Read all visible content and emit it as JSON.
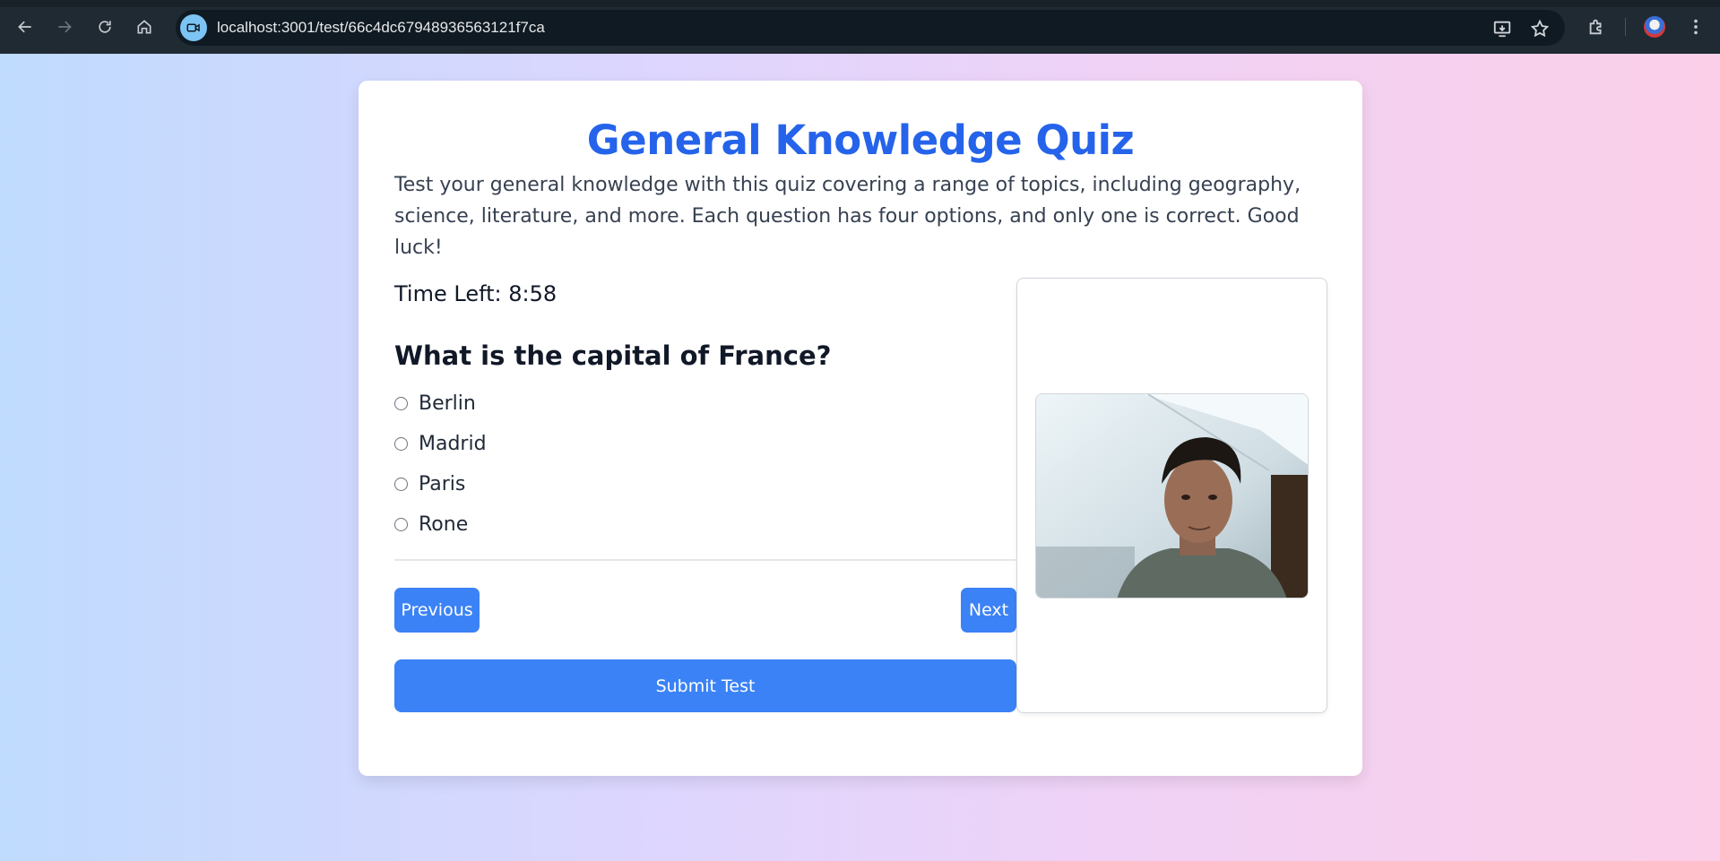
{
  "browser": {
    "url": "localhost:3001/test/66c4dc67948936563121f7ca"
  },
  "quiz": {
    "title": "General Knowledge Quiz",
    "description": "Test your general knowledge with this quiz covering a range of topics, including geography, science, literature, and more. Each question has four options, and only one is correct. Good luck!",
    "timer": "Time Left: 8:58",
    "question": "What is the capital of France?",
    "options": [
      "Berlin",
      "Madrid",
      "Paris",
      "Rone"
    ],
    "previous_label": "Previous",
    "next_label": "Next",
    "submit_label": "Submit Test"
  },
  "colors": {
    "accent": "#3b82f6",
    "title": "#2563eb"
  }
}
